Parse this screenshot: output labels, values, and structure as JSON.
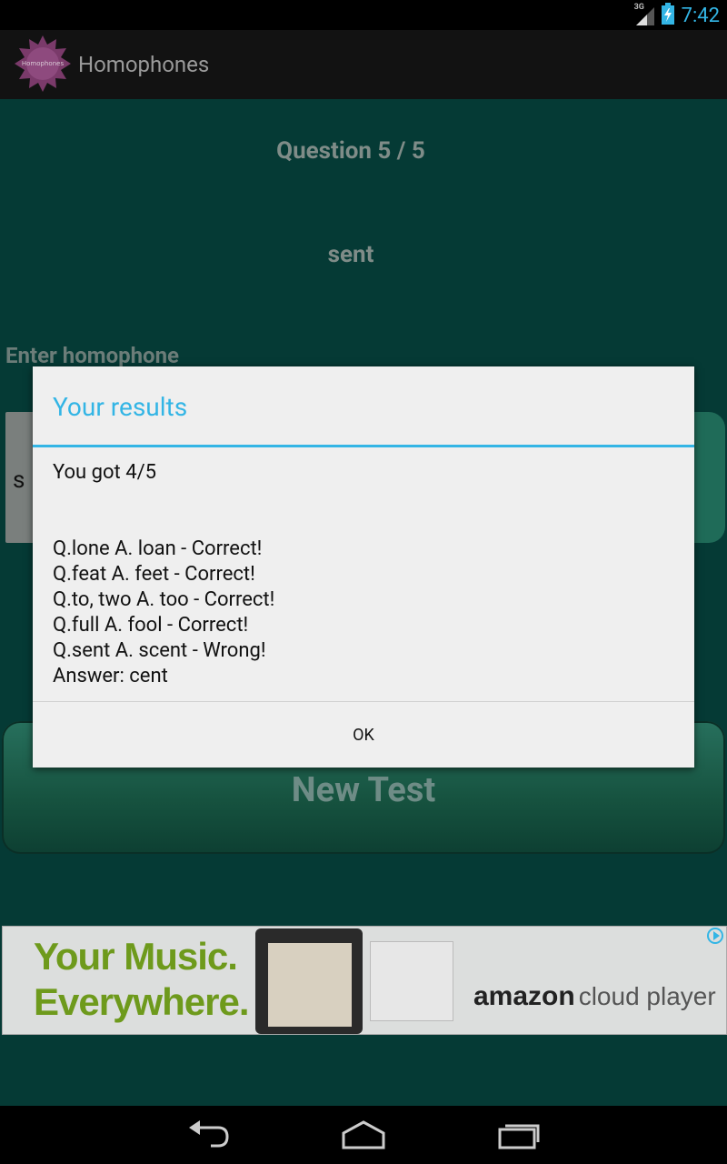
{
  "status_bar": {
    "network": "3G",
    "time": "7:42"
  },
  "app_bar": {
    "title": "Homophones",
    "icon_text": "Homophones"
  },
  "screen": {
    "question_counter": "Question 5 / 5",
    "current_word": "sent",
    "input_label": "Enter homophone",
    "input_value": "s",
    "new_test_label": "New Test"
  },
  "dialog": {
    "title": "Your results",
    "score": "You got 4/5",
    "results": [
      "Q.lone A. loan - Correct!",
      "Q.feat A. feet - Correct!",
      "Q.to, two A. too - Correct!",
      "Q.full A. fool - Correct!",
      "Q.sent A. scent - Wrong!",
      "Answer: cent"
    ],
    "ok_label": "OK"
  },
  "ad": {
    "headline_line1": "Your Music.",
    "headline_line2": "Everywhere.",
    "brand": "amazon",
    "product": "cloud player"
  },
  "colors": {
    "accent": "#33b5e5",
    "background": "#053a35",
    "dialog_bg": "#efefef",
    "ad_green": "#6e9a1c"
  }
}
